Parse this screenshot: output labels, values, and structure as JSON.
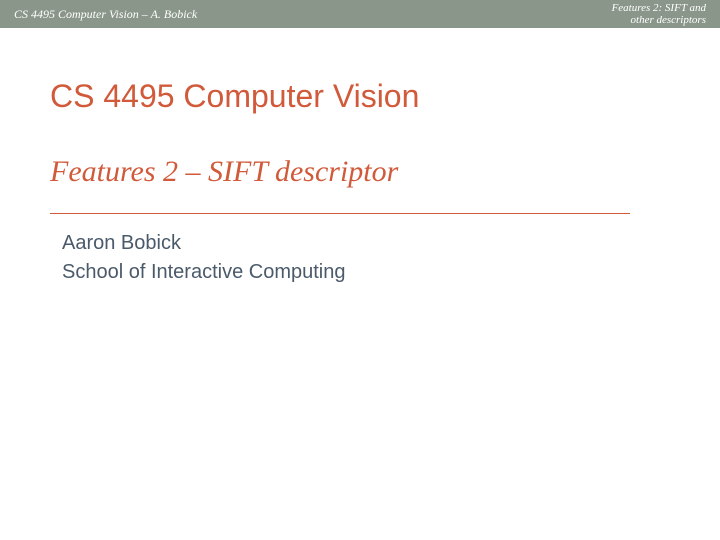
{
  "header": {
    "left": "CS 4495 Computer Vision – A. Bobick",
    "right_line1": "Features 2: SIFT and",
    "right_line2": "other descriptors"
  },
  "slide": {
    "course_title": "CS 4495 Computer Vision",
    "lecture_title": "Features 2 – SIFT descriptor",
    "author": "Aaron Bobick",
    "school": "School of Interactive Computing"
  }
}
